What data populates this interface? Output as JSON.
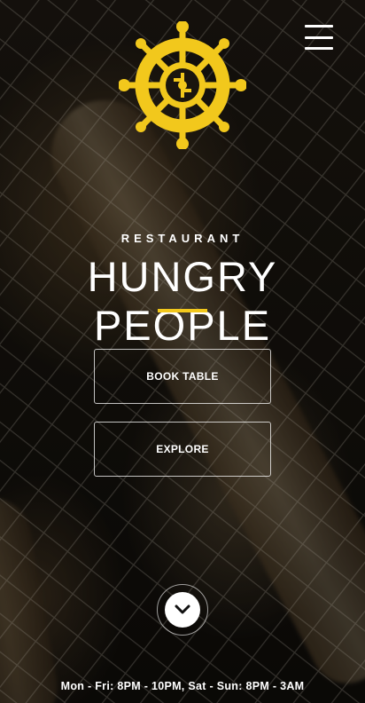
{
  "nav": {
    "menu_icon": "hamburger-menu-icon"
  },
  "logo": {
    "icon": "ship-wheel-icon",
    "color": "#f2c81c"
  },
  "hero": {
    "subtitle": "RESTAURANT",
    "title": "HUNGRY PEOPLE",
    "accent_color": "#f2c81c",
    "background": "grilled fish on grill photo"
  },
  "actions": {
    "book_label": "BOOK TABLE",
    "explore_label": "EXPLORE"
  },
  "scroll": {
    "icon": "chevron-down-icon"
  },
  "footer": {
    "hours": "Mon - Fri: 8PM - 10PM, Sat - Sun: 8PM - 3AM"
  }
}
